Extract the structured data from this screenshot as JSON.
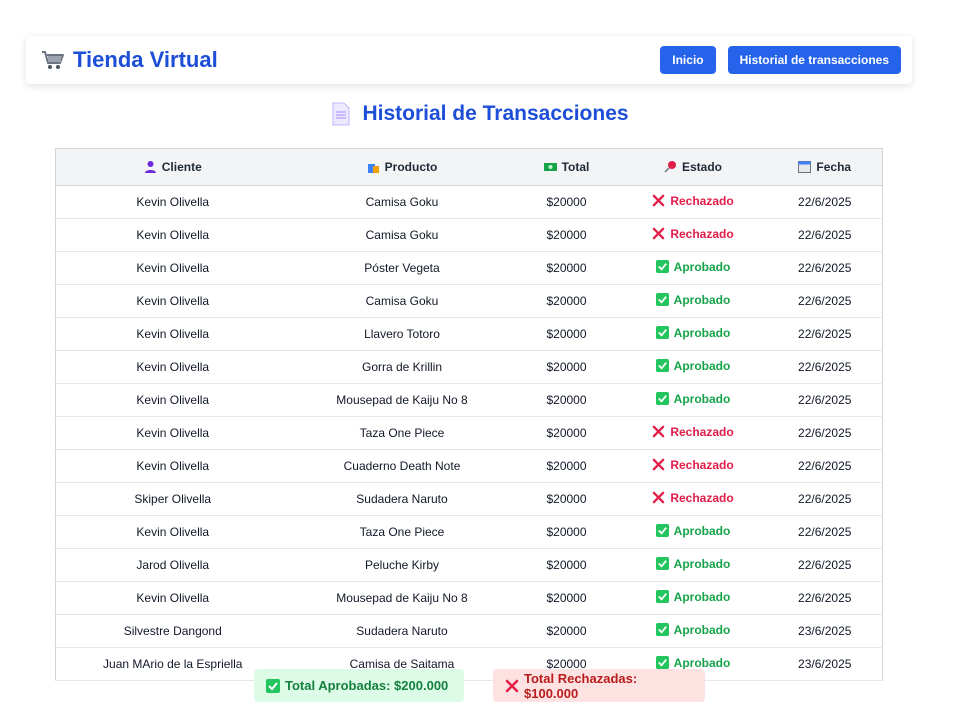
{
  "brand": {
    "title": "Tienda Virtual",
    "icon": "shopping-cart-icon"
  },
  "nav": {
    "home_label": "Inicio",
    "history_label": "Historial de transacciones"
  },
  "page": {
    "title": "Historial de Transacciones",
    "icon": "document-icon"
  },
  "table": {
    "headers": {
      "cliente": "Cliente",
      "producto": "Producto",
      "total": "Total",
      "estado": "Estado",
      "fecha": "Fecha"
    },
    "rows": [
      {
        "cliente": "Kevin Olivella",
        "producto": "Camisa Goku",
        "total": "$20000",
        "estado": "Rechazado",
        "status": "bad",
        "fecha": "22/6/2025"
      },
      {
        "cliente": "Kevin Olivella",
        "producto": "Camisa Goku",
        "total": "$20000",
        "estado": "Rechazado",
        "status": "bad",
        "fecha": "22/6/2025"
      },
      {
        "cliente": "Kevin Olivella",
        "producto": "Póster Vegeta",
        "total": "$20000",
        "estado": "Aprobado",
        "status": "ok",
        "fecha": "22/6/2025"
      },
      {
        "cliente": "Kevin Olivella",
        "producto": "Camisa Goku",
        "total": "$20000",
        "estado": "Aprobado",
        "status": "ok",
        "fecha": "22/6/2025"
      },
      {
        "cliente": "Kevin Olivella",
        "producto": "Llavero Totoro",
        "total": "$20000",
        "estado": "Aprobado",
        "status": "ok",
        "fecha": "22/6/2025"
      },
      {
        "cliente": "Kevin Olivella",
        "producto": "Gorra de Krillin",
        "total": "$20000",
        "estado": "Aprobado",
        "status": "ok",
        "fecha": "22/6/2025"
      },
      {
        "cliente": "Kevin Olivella",
        "producto": "Mousepad de Kaiju No 8",
        "total": "$20000",
        "estado": "Aprobado",
        "status": "ok",
        "fecha": "22/6/2025"
      },
      {
        "cliente": "Kevin Olivella",
        "producto": "Taza One Piece",
        "total": "$20000",
        "estado": "Rechazado",
        "status": "bad",
        "fecha": "22/6/2025"
      },
      {
        "cliente": "Kevin Olivella",
        "producto": "Cuaderno Death Note",
        "total": "$20000",
        "estado": "Rechazado",
        "status": "bad",
        "fecha": "22/6/2025"
      },
      {
        "cliente": "Skiper Olivella",
        "producto": "Sudadera Naruto",
        "total": "$20000",
        "estado": "Rechazado",
        "status": "bad",
        "fecha": "22/6/2025"
      },
      {
        "cliente": "Kevin Olivella",
        "producto": "Taza One Piece",
        "total": "$20000",
        "estado": "Aprobado",
        "status": "ok",
        "fecha": "22/6/2025"
      },
      {
        "cliente": "Jarod Olivella",
        "producto": "Peluche Kirby",
        "total": "$20000",
        "estado": "Aprobado",
        "status": "ok",
        "fecha": "22/6/2025"
      },
      {
        "cliente": "Kevin Olivella",
        "producto": "Mousepad de Kaiju No 8",
        "total": "$20000",
        "estado": "Aprobado",
        "status": "ok",
        "fecha": "22/6/2025"
      },
      {
        "cliente": "Silvestre Dangond",
        "producto": "Sudadera Naruto",
        "total": "$20000",
        "estado": "Aprobado",
        "status": "ok",
        "fecha": "23/6/2025"
      },
      {
        "cliente": "Juan MArio de la Espriella",
        "producto": "Camisa de Saitama",
        "total": "$20000",
        "estado": "Aprobado",
        "status": "ok",
        "fecha": "23/6/2025"
      }
    ]
  },
  "totals": {
    "approved_label": "Total Aprobadas: $200.000",
    "rejected_label": "Total Rechazadas: $100.000"
  },
  "colors": {
    "accent": "#2563eb",
    "approved": "#16a34a",
    "rejected": "#e11d48"
  }
}
